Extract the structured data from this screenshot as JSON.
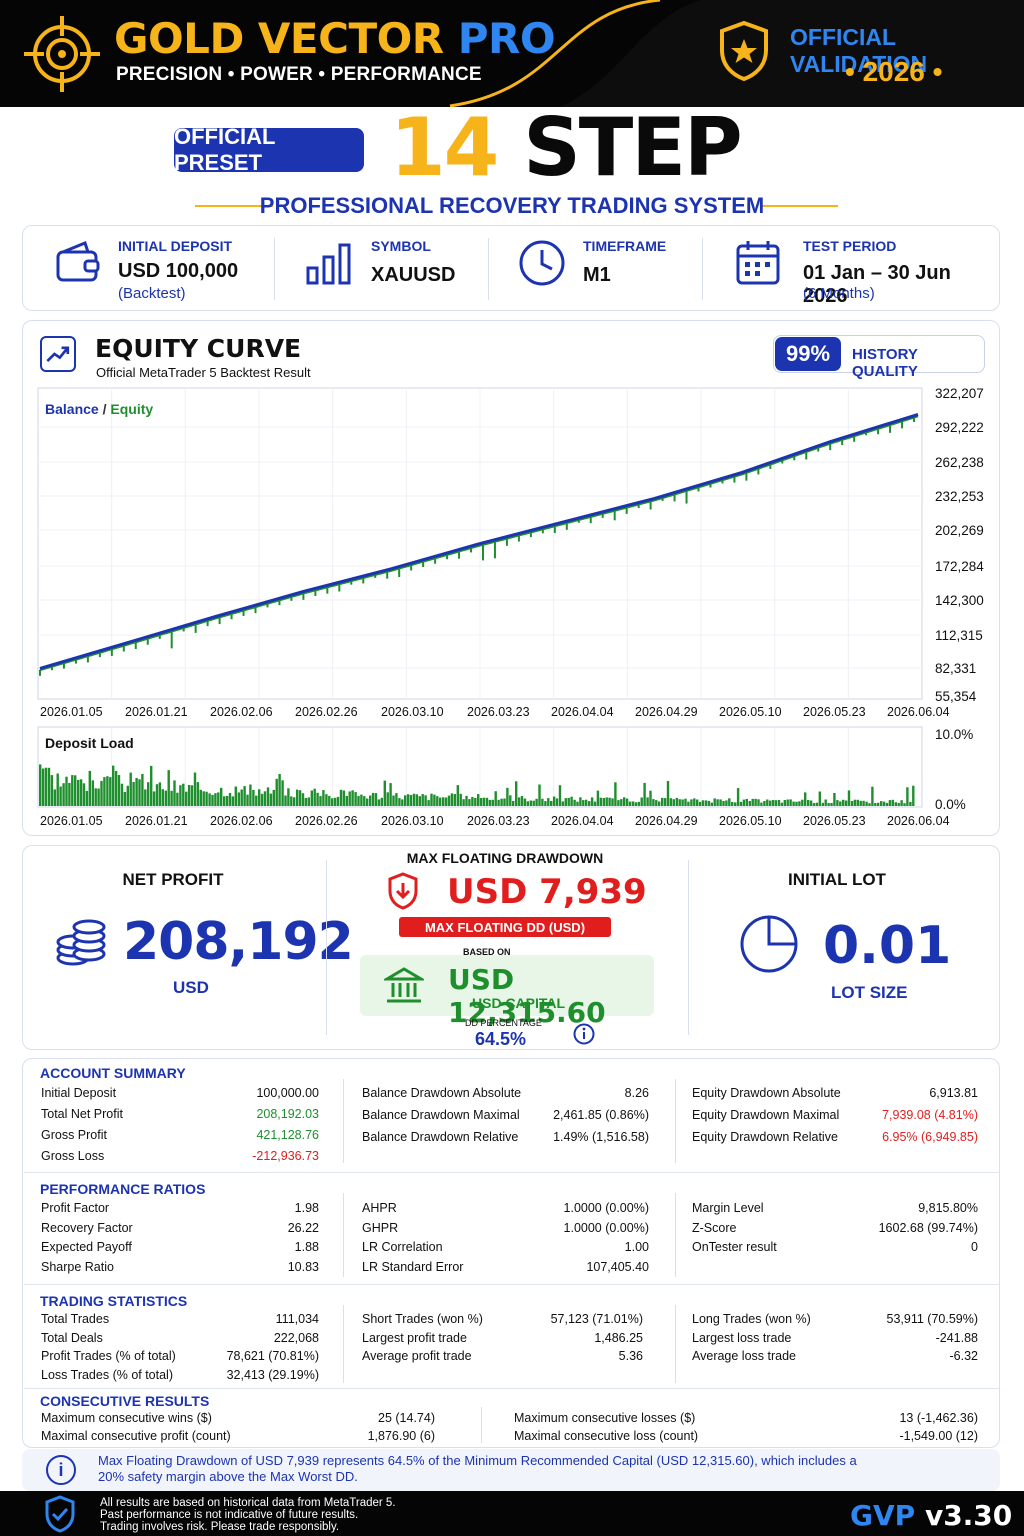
{
  "header": {
    "brand_part1": "GOLD VECTOR",
    "brand_part2": "PRO",
    "tagline": "PRECISION • POWER • PERFORMANCE",
    "validation_title": "OFFICIAL VALIDATION",
    "validation_year": "• 2026 •",
    "logo_icon": "crosshair-target-icon",
    "badge_icon": "shield-star-icon"
  },
  "title": {
    "preset_badge": "OFFICIAL PRESET",
    "step_number": "14",
    "step_word": "STEP",
    "subtitle": "PROFESSIONAL RECOVERY TRADING SYSTEM"
  },
  "info": {
    "deposit_label": "INITIAL DEPOSIT",
    "deposit_value": "USD 100,000",
    "deposit_sub": "(Backtest)",
    "symbol_label": "SYMBOL",
    "symbol_value": "XAUUSD",
    "timeframe_label": "TIMEFRAME",
    "timeframe_value": "M1",
    "period_label": "TEST PERIOD",
    "period_value": "01 Jan – 30 Jun 2026",
    "period_sub": "(6 Months)"
  },
  "equity": {
    "title": "EQUITY CURVE",
    "subtitle": "Official MetaTrader 5 Backtest Result",
    "quality_pct": "99%",
    "quality_label": "HISTORY QUALITY"
  },
  "chart_data": [
    {
      "type": "line",
      "title": "",
      "legend": [
        "Balance",
        "Equity"
      ],
      "legend_sep": "/",
      "x": [
        "2026.01.05",
        "2026.01.21",
        "2026.02.06",
        "2026.02.26",
        "2026.03.10",
        "2026.03.23",
        "2026.04.04",
        "2026.04.29",
        "2026.05.10",
        "2026.05.23",
        "2026.06.04"
      ],
      "y_ticks": [
        "322,207",
        "292,222",
        "262,238",
        "232,253",
        "202,269",
        "172,284",
        "142,300",
        "112,315",
        "82,331",
        "55,354"
      ],
      "ylim": [
        55354,
        322207
      ],
      "series": [
        {
          "name": "Balance",
          "color": "#1d34b0",
          "values": [
            82331,
            105000,
            128000,
            150000,
            170000,
            192000,
            212000,
            232000,
            255000,
            282000,
            306000
          ]
        },
        {
          "name": "Equity",
          "color": "#1f8f2d",
          "values": [
            81000,
            103500,
            126500,
            148500,
            168500,
            190500,
            210500,
            230500,
            253500,
            280500,
            304500
          ]
        }
      ],
      "legend_position": "top-left",
      "grid": true
    },
    {
      "type": "bar",
      "title": "Deposit Load",
      "x": [
        "2026.01.05",
        "2026.01.21",
        "2026.02.06",
        "2026.02.26",
        "2026.03.10",
        "2026.03.23",
        "2026.04.04",
        "2026.04.29",
        "2026.05.10",
        "2026.05.23",
        "2026.06.04"
      ],
      "y_ticks": [
        "10.0%",
        "0.0%"
      ],
      "ylim": [
        0,
        10
      ],
      "color": "#1f8f2d"
    }
  ],
  "metrics": {
    "net_profit_title": "NET PROFIT",
    "net_profit_value": "208,192",
    "net_profit_unit": "USD",
    "dd_title": "MAX FLOATING DRAWDOWN",
    "dd_value": "USD 7,939",
    "dd_badge": "MAX FLOATING DD (USD)",
    "based_on": "BASED ON",
    "capital_value": "USD 12,315.60",
    "capital_label": "USD CAPITAL",
    "dd_pct_label": "DD PERCENTAGE",
    "dd_pct_value": "64.5%",
    "lot_title": "INITIAL LOT",
    "lot_value": "0.01",
    "lot_unit": "LOT SIZE"
  },
  "account_summary": {
    "title": "ACCOUNT SUMMARY",
    "col1": [
      {
        "k": "Initial Deposit",
        "v": "100,000.00"
      },
      {
        "k": "Total Net Profit",
        "v": "208,192.03"
      },
      {
        "k": "Gross Profit",
        "v": "421,128.76"
      },
      {
        "k": "Gross Loss",
        "v": "-212,936.73"
      }
    ],
    "col2": [
      {
        "k": "Balance Drawdown Absolute",
        "v": "8.26"
      },
      {
        "k": "Balance Drawdown Maximal",
        "v": "2,461.85 (0.86%)"
      },
      {
        "k": "Balance Drawdown Relative",
        "v": "1.49% (1,516.58)"
      }
    ],
    "col3": [
      {
        "k": "Equity Drawdown Absolute",
        "v": "6,913.81"
      },
      {
        "k": "Equity Drawdown Maximal",
        "v": "7,939.08 (4.81%)"
      },
      {
        "k": "Equity Drawdown Relative",
        "v": "6.95% (6,949.85)"
      }
    ]
  },
  "performance": {
    "title": "PERFORMANCE RATIOS",
    "col1": [
      {
        "k": "Profit Factor",
        "v": "1.98"
      },
      {
        "k": "Recovery Factor",
        "v": "26.22"
      },
      {
        "k": "Expected Payoff",
        "v": "1.88"
      },
      {
        "k": "Sharpe Ratio",
        "v": "10.83"
      }
    ],
    "col2": [
      {
        "k": "AHPR",
        "v": "1.0000 (0.00%)"
      },
      {
        "k": "GHPR",
        "v": "1.0000 (0.00%)"
      },
      {
        "k": "LR Correlation",
        "v": "1.00"
      },
      {
        "k": "LR Standard Error",
        "v": "107,405.40"
      }
    ],
    "col3": [
      {
        "k": "Margin Level",
        "v": "9,815.80%"
      },
      {
        "k": "Z-Score",
        "v": "1602.68 (99.74%)"
      },
      {
        "k": "OnTester result",
        "v": "0"
      }
    ]
  },
  "trading": {
    "title": "TRADING STATISTICS",
    "col1": [
      {
        "k": "Total Trades",
        "v": "111,034"
      },
      {
        "k": "Total Deals",
        "v": "222,068"
      },
      {
        "k": "Profit Trades (% of total)",
        "v": "78,621 (70.81%)"
      },
      {
        "k": "Loss Trades (% of total)",
        "v": "32,413 (29.19%)"
      }
    ],
    "col2": [
      {
        "k": "Short Trades (won %)",
        "v": "57,123 (71.01%)"
      },
      {
        "k": "Largest profit trade",
        "v": "1,486.25"
      },
      {
        "k": "Average profit trade",
        "v": "5.36"
      }
    ],
    "col3": [
      {
        "k": "Long Trades (won %)",
        "v": "53,911 (70.59%)"
      },
      {
        "k": "Largest loss trade",
        "v": "-241.88"
      },
      {
        "k": "Average loss trade",
        "v": "-6.32"
      }
    ]
  },
  "consecutive": {
    "title": "CONSECUTIVE RESULTS",
    "col1": [
      {
        "k": "Maximum consecutive wins ($)",
        "v": "25 (14.74)"
      },
      {
        "k": "Maximal consecutive profit (count)",
        "v": "1,876.90 (6)"
      }
    ],
    "col2": [
      {
        "k": "Maximum consecutive losses ($)",
        "v": "13 (-1,462.36)"
      },
      {
        "k": "Maximal consecutive loss (count)",
        "v": "-1,549.00 (12)"
      }
    ]
  },
  "note": {
    "text": "Max Floating Drawdown of USD 7,939 represents 64.5% of the Minimum Recommended Capital (USD 12,315.60), which includes a 20% safety margin above the Max Worst DD."
  },
  "footer": {
    "line1": "All results are based on historical data from MetaTrader 5.",
    "line2": "Past performance is not indicative of future results.",
    "line3": "Trading involves risk. Please trade responsibly.",
    "brand": "GVP",
    "version": "v3.30"
  },
  "colors": {
    "gold": "#f6b41a",
    "blue": "#1d34b0",
    "sky": "#2f86f0",
    "green": "#1f8f2d",
    "red": "#e01e1e"
  }
}
